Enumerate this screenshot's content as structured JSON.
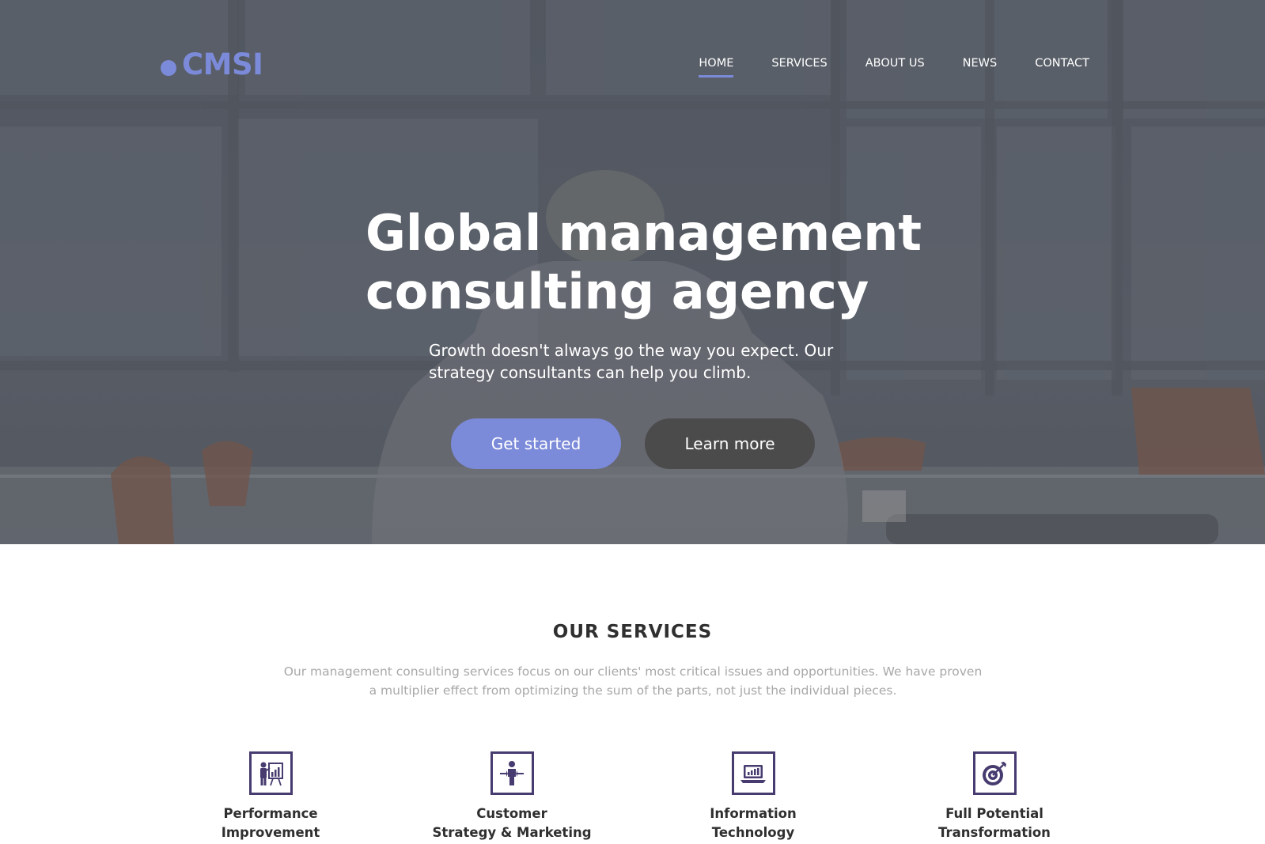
{
  "brand": {
    "name": "CMSI",
    "accent_color": "#7b8ad9"
  },
  "nav": {
    "items": [
      {
        "label": "HOME",
        "active": true
      },
      {
        "label": "SERVICES",
        "active": false
      },
      {
        "label": "ABOUT US",
        "active": false
      },
      {
        "label": "NEWS",
        "active": false
      },
      {
        "label": "CONTACT",
        "active": false
      }
    ]
  },
  "hero": {
    "title_line1": "Global management",
    "title_line2": "consulting agency",
    "subtitle_line1": "Growth doesn't always go the way you expect. Our",
    "subtitle_line2": "strategy consultants can help you climb.",
    "primary_button": "Get started",
    "secondary_button": "Learn more"
  },
  "services": {
    "title": "OUR SERVICES",
    "desc_line1": "Our management consulting services focus on our clients' most critical issues and opportunities. We have proven",
    "desc_line2": "a multiplier effect from optimizing the sum of the parts, not just the individual pieces.",
    "icon_color": "#473b6f",
    "items": [
      {
        "icon": "presentation-icon",
        "line1": "Performance",
        "line2": "Improvement"
      },
      {
        "icon": "person-arrows-icon",
        "line1": "Customer",
        "line2": "Strategy & Marketing"
      },
      {
        "icon": "laptop-chart-icon",
        "line1": "Information",
        "line2": "Technology"
      },
      {
        "icon": "target-icon",
        "line1": "Full Potential",
        "line2": "Transformation"
      }
    ]
  }
}
